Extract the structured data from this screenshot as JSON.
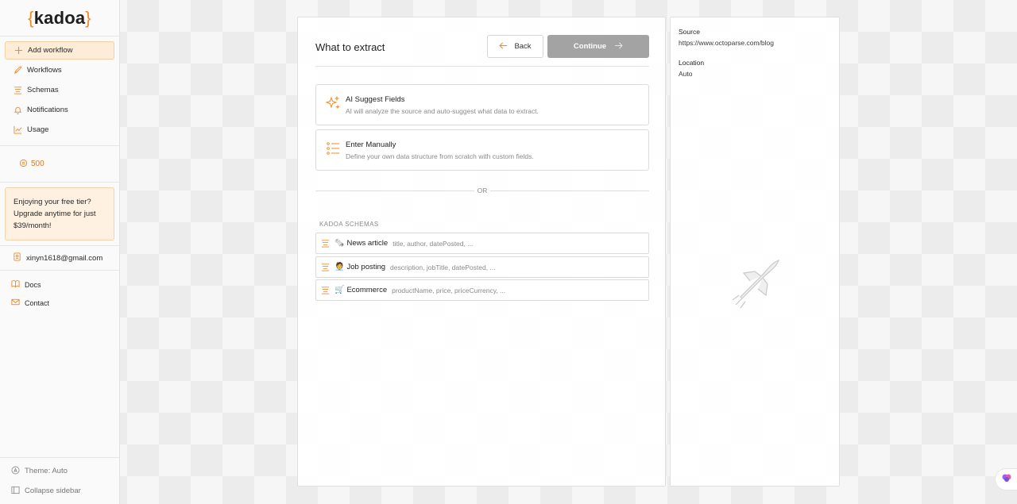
{
  "sidebar": {
    "logo": {
      "open": "{",
      "text": "kadoa",
      "close": "}"
    },
    "nav": [
      {
        "label": "Add workflow",
        "icon": "plus-icon",
        "active": true
      },
      {
        "label": "Workflows",
        "icon": "rocket-icon"
      },
      {
        "label": "Schemas",
        "icon": "schema-icon"
      },
      {
        "label": "Notifications",
        "icon": "bell-icon"
      },
      {
        "label": "Usage",
        "icon": "chart-line-icon"
      }
    ],
    "credits": "500",
    "upgrade_text": "Enjoying your free tier? Upgrade anytime for just $39/month!",
    "account_email": "xinyn1618@gmail.com",
    "links": [
      {
        "label": "Docs",
        "icon": "book-icon"
      },
      {
        "label": "Contact",
        "icon": "mail-icon"
      }
    ],
    "bottom": {
      "theme": "Theme: Auto",
      "collapse": "Collapse sidebar"
    }
  },
  "main": {
    "title": "What to extract",
    "back_label": "Back",
    "continue_label": "Continue",
    "options": [
      {
        "title": "AI Suggest Fields",
        "desc": "AI will analyze the source and auto-suggest what data to extract.",
        "icon": "sparkle-icon"
      },
      {
        "title": "Enter Manually",
        "desc": "Define your own data structure from scratch with custom fields.",
        "icon": "list-icon"
      }
    ],
    "or_label": "OR",
    "schemas_label": "KADOA SCHEMAS",
    "schemas": [
      {
        "emoji": "🗞️",
        "name": "News article",
        "fields": "title, author, datePosted, ..."
      },
      {
        "emoji": "🧑‍💼",
        "name": "Job posting",
        "fields": "description, jobTitle, datePosted, ..."
      },
      {
        "emoji": "🛒",
        "name": "Ecommerce",
        "fields": "productName, price, priceCurrency, ..."
      }
    ]
  },
  "side": {
    "source_label": "Source",
    "source_value": "https://www.octoparse.com/blog",
    "location_label": "Location",
    "location_value": "Auto"
  },
  "colors": {
    "accent": "#f08a24",
    "disabled_button": "#a3a3a3"
  }
}
